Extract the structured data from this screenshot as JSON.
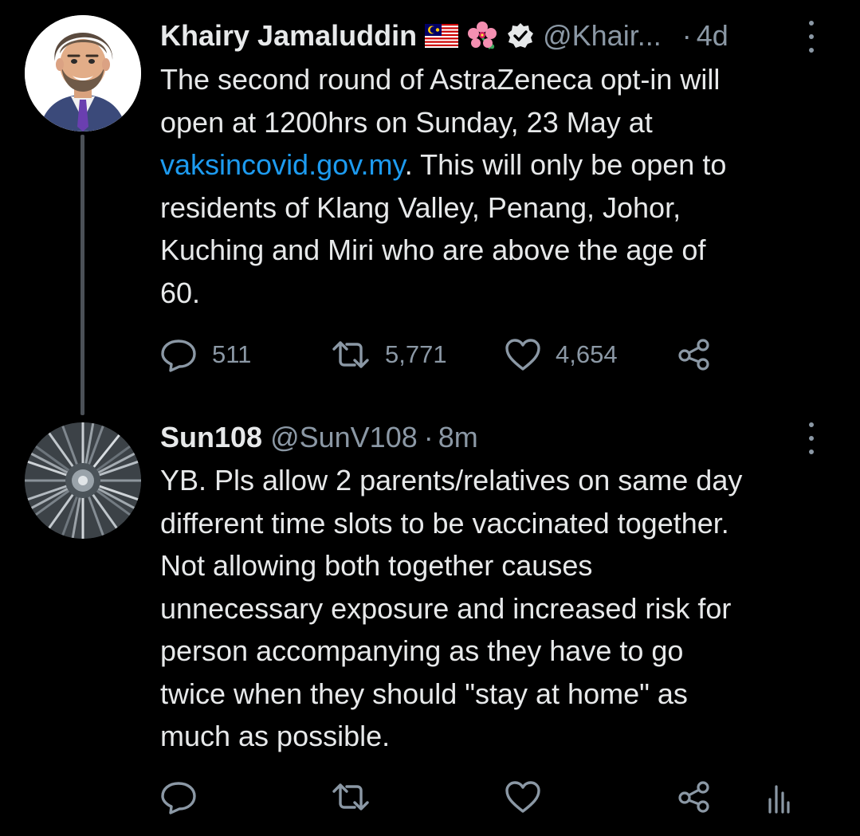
{
  "tweets": [
    {
      "display_name": "Khairy Jamaluddin",
      "handle": "@Khair...",
      "separator": "·",
      "time": "4d",
      "text_lead": "The second round of AstraZeneca opt-in will\nopen at 1200hrs on Sunday, 23 May at\n",
      "link_text": "vaksincovid.gov.my",
      "text_tail": ". This will only be open to\nresidents of Klang Valley, Penang, Johor,\nKuching and Miri who are above the age of\n60.",
      "replies": "511",
      "retweets": "5,771",
      "likes": "4,654",
      "badges": [
        "malaysia-flag-icon",
        "hibiscus-icon",
        "verified-badge-icon"
      ]
    },
    {
      "display_name": "Sun108",
      "handle": "@SunV108",
      "separator": "·",
      "time": "8m",
      "text": "YB. Pls allow 2 parents/relatives on same day\ndifferent time slots to be vaccinated together.\nNot allowing both together causes\nunnecessary exposure and increased risk for\nperson accompanying as they have to go\ntwice when they should \"stay at home\" as\nmuch as possible."
    }
  ],
  "colors": {
    "background": "#000000",
    "primary_text": "#e7e9ea",
    "secondary_text": "#8b98a5",
    "link": "#1d9bf0",
    "thread_line": "#4b5057"
  }
}
